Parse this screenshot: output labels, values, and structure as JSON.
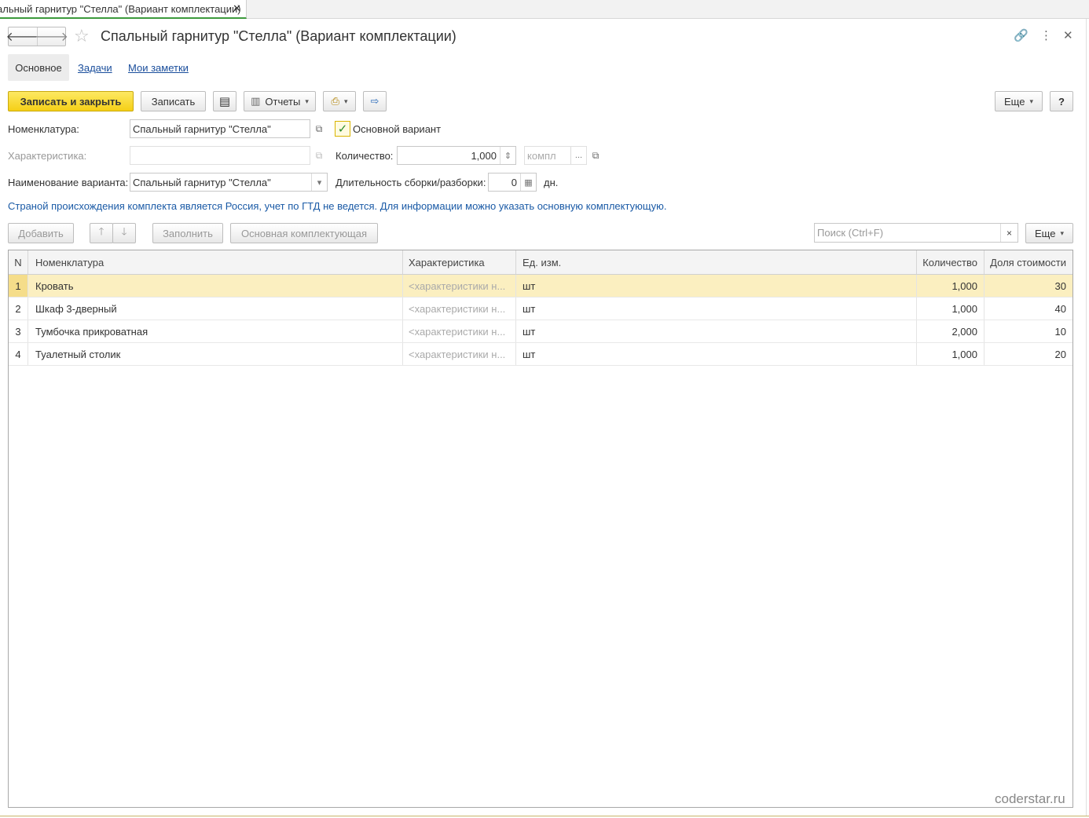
{
  "tab": {
    "title": "альный гарнитур \"Стелла\" (Вариант комплектации)",
    "close": "✕"
  },
  "header": {
    "back": "🡐",
    "forward": "🡒",
    "star": "☆",
    "title": "Спальный гарнитур \"Стелла\" (Вариант комплектации)",
    "link_icon": "🔗",
    "more_icon": "⋮",
    "close_icon": "✕"
  },
  "subtabs": {
    "main": "Основное",
    "tasks": "Задачи",
    "notes": "Мои заметки"
  },
  "toolbar": {
    "save_close": "Записать и закрыть",
    "save": "Записать",
    "list_icon": "▤",
    "reports": "Отчеты",
    "reports_icon": "▥",
    "print_icon": "⎙",
    "export_icon": "⇨",
    "more": "Еще",
    "help": "?"
  },
  "form": {
    "nomenclature_label": "Номенклатура:",
    "nomenclature_value": "Спальный гарнитур \"Стелла\"",
    "main_variant_label": "Основной вариант",
    "main_variant_check": "✓",
    "characteristic_label": "Характеристика:",
    "characteristic_value": "",
    "quantity_label": "Количество:",
    "quantity_value": "1,000",
    "unit_placeholder": "компл",
    "variant_name_label": "Наименование варианта:",
    "variant_name_value": "Спальный гарнитур \"Стелла\"",
    "duration_label": "Длительность сборки/разборки:",
    "duration_value": "0",
    "duration_unit": "дн.",
    "ext_icon": "⧉",
    "dropdown_icon": "▾",
    "spin_icon": "⇕",
    "dots": "...",
    "calc_icon": "▦"
  },
  "info": "Страной происхождения комплекта является Россия, учет по ГТД не ведется. Для информации можно указать основную комплектующую.",
  "table_toolbar": {
    "add": "Добавить",
    "up": "🡑",
    "down": "🡓",
    "fill": "Заполнить",
    "main_component": "Основная комплектующая",
    "search_placeholder": "Поиск (Ctrl+F)",
    "clear": "×",
    "more": "Еще"
  },
  "table": {
    "columns": [
      "N",
      "Номенклатура",
      "Характеристика",
      "Ед. изм.",
      "Количество",
      "Доля стоимости"
    ],
    "rows": [
      {
        "n": "1",
        "name": "Кровать",
        "char": "<характеристики н...",
        "unit": "шт",
        "qty": "1,000",
        "share": "30"
      },
      {
        "n": "2",
        "name": "Шкаф 3-дверный",
        "char": "<характеристики н...",
        "unit": "шт",
        "qty": "1,000",
        "share": "40"
      },
      {
        "n": "3",
        "name": "Тумбочка прикроватная",
        "char": "<характеристики н...",
        "unit": "шт",
        "qty": "2,000",
        "share": "10"
      },
      {
        "n": "4",
        "name": "Туалетный столик",
        "char": "<характеристики н...",
        "unit": "шт",
        "qty": "1,000",
        "share": "20"
      }
    ]
  },
  "watermark": "coderstar.ru"
}
